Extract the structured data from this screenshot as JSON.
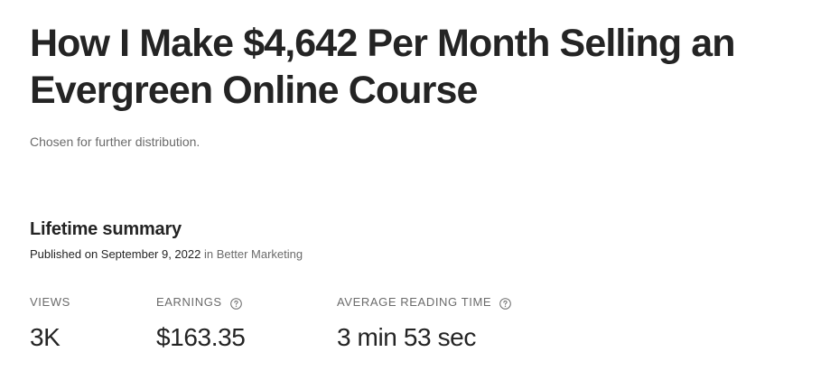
{
  "story": {
    "title_line_1": "How I Make $4,642 Per Month Selling an",
    "title_line_2": "Evergreen Online Course",
    "distribution_note": "Chosen for further distribution."
  },
  "summary": {
    "heading": "Lifetime summary",
    "published_prefix": "Published on September 9, 2022",
    "published_in": "in Better Marketing"
  },
  "stats": {
    "views_label": "VIEWS",
    "views_value": "3K",
    "earnings_label": "EARNINGS",
    "earnings_value": "$163.35",
    "reading_label": "AVERAGE READING TIME",
    "reading_value": "3 min 53 sec",
    "help_icon": "question-circle-icon"
  },
  "colors": {
    "text_primary": "#242424",
    "text_secondary": "#6b6b6b",
    "background": "#ffffff"
  }
}
